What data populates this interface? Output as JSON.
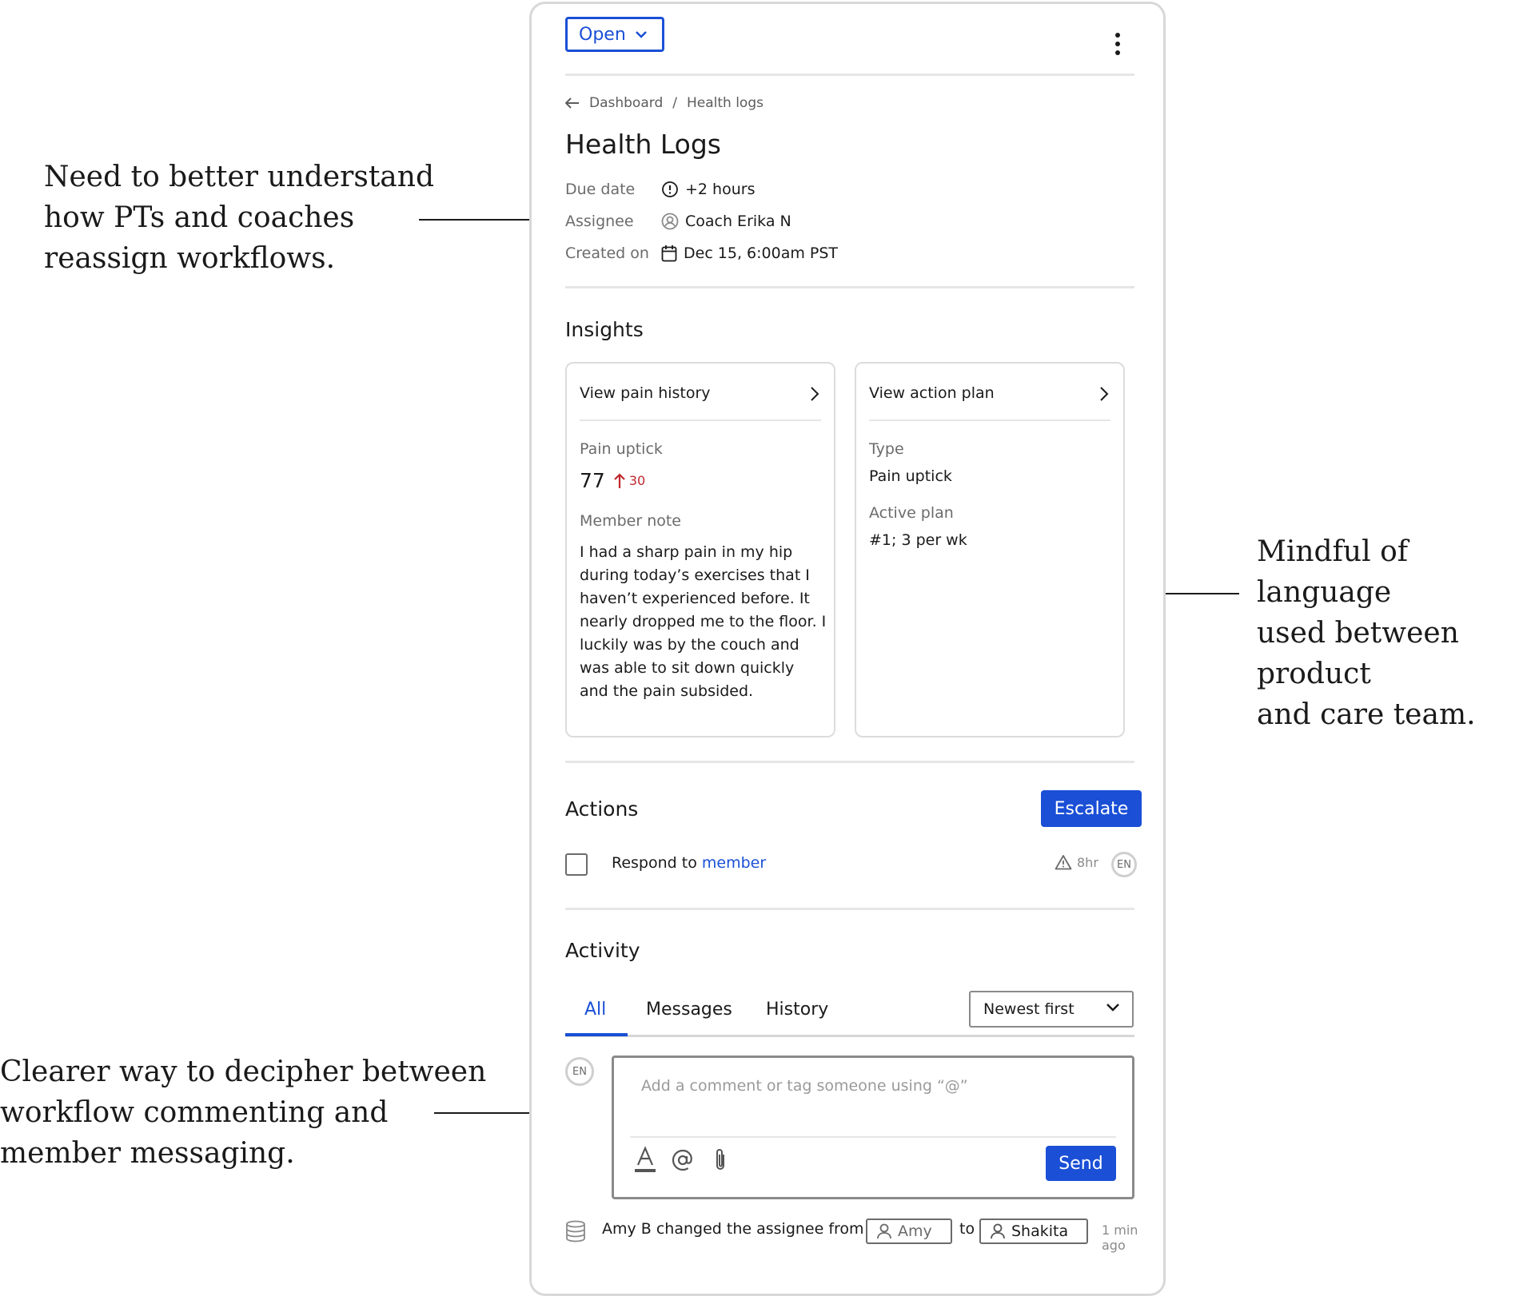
{
  "annotations": [
    "Need to better understand\nhow PTs and coaches\nreassign workflows.",
    "Mindful of language\nused between product\nand care team.",
    "Clearer way to decipher between\nworkflow commenting and\nmember messaging."
  ],
  "header": {
    "status": "Open"
  },
  "breadcrumb": {
    "root": "Dashboard",
    "separator": "/",
    "current": "Health logs"
  },
  "page": {
    "title": "Health Logs",
    "meta": {
      "due_label": "Due date",
      "due_value": "+2 hours",
      "assignee_label": "Assignee",
      "assignee_value": "Coach Erika N",
      "created_label": "Created on",
      "created_value": "Dec 15, 6:00am PST"
    }
  },
  "insights": {
    "heading": "Insights",
    "pain_card": {
      "link": "View pain history",
      "metric_label": "Pain uptick",
      "metric_value": "77",
      "metric_delta": "30",
      "note_label": "Member note",
      "note": "I had a sharp pain in my hip during today’s exercises that I haven’t experienced before. It nearly dropped me to the floor. I luckily was by the couch and was able to sit down quickly and the pain subsided."
    },
    "plan_card": {
      "link": "View action plan",
      "type_label": "Type",
      "type_value": "Pain uptick",
      "plan_label": "Active plan",
      "plan_value": "#1; 3 per wk"
    }
  },
  "actions": {
    "heading": "Actions",
    "escalate": "Escalate",
    "task": {
      "prefix": "Respond to ",
      "link": "member",
      "due": "8hr",
      "avatar": "EN"
    }
  },
  "activity": {
    "heading": "Activity",
    "tabs": [
      "All",
      "Messages",
      "History"
    ],
    "active_tab": "All",
    "sort": "Newest first",
    "composer": {
      "avatar": "EN",
      "placeholder": "Add a comment or tag someone using “@”",
      "send": "Send"
    },
    "history": {
      "text": "Amy B changed the assignee from",
      "from": "Amy",
      "to_word": "to",
      "to": "Shakita",
      "time": "1 min ago"
    }
  },
  "colors": {
    "accent": "#1a4fd6",
    "alert": "#c0282d",
    "border": "#d8d8d8"
  }
}
